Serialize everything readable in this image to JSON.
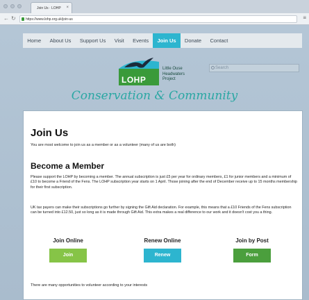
{
  "browser": {
    "tab_title": "Join Us · LOHP",
    "url": "https://www.lohp.org.uk/join-us"
  },
  "nav": {
    "items": [
      {
        "label": "Home"
      },
      {
        "label": "About Us"
      },
      {
        "label": "Support Us"
      },
      {
        "label": "Visit"
      },
      {
        "label": "Events"
      },
      {
        "label": "Join Us",
        "active": true
      },
      {
        "label": "Donate"
      },
      {
        "label": "Contact"
      }
    ]
  },
  "header": {
    "logo_text": "LOHP",
    "org_name_line1": "Little Ouse",
    "org_name_line2": "Headwaters",
    "org_name_line3": "Project",
    "search_placeholder": "Search",
    "tagline": "Conservation & Community"
  },
  "content": {
    "title": "Join Us",
    "welcome": "You are most welcome to join us as a member or as a volunteer (many of us are both)",
    "member_heading": "Become a Member",
    "para1": "Please support the LOHP by becoming a member. The annual subscription is just £5 per year for ordinary members, £1 for junior members and a minimum of £10 to become a Friend of the Fens. The LOHP subscription year starts on 1 April. Those joining after the end of December receive up to 15 months membership for their first subscription.",
    "para2": "UK tax payers can make their subscriptions go further by signing the Gift Aid declaration. For example, this means that a £10 Friends of the Fens subscription can be turned into £12.50, just so long as it is made through Gift Aid. This extra makes a real difference to our work and it doesn't cost you a thing.",
    "columns": [
      {
        "title": "Join Online",
        "button": "Join"
      },
      {
        "title": "Renew Online",
        "button": "Renew"
      },
      {
        "title": "Join by Post",
        "button": "Form"
      }
    ],
    "volunteer_note": "There are many opportunities to volunteer according to your interests"
  },
  "colors": {
    "accent_teal": "#2db5cf",
    "green": "#86c447",
    "dark_green": "#4b9f3d"
  }
}
